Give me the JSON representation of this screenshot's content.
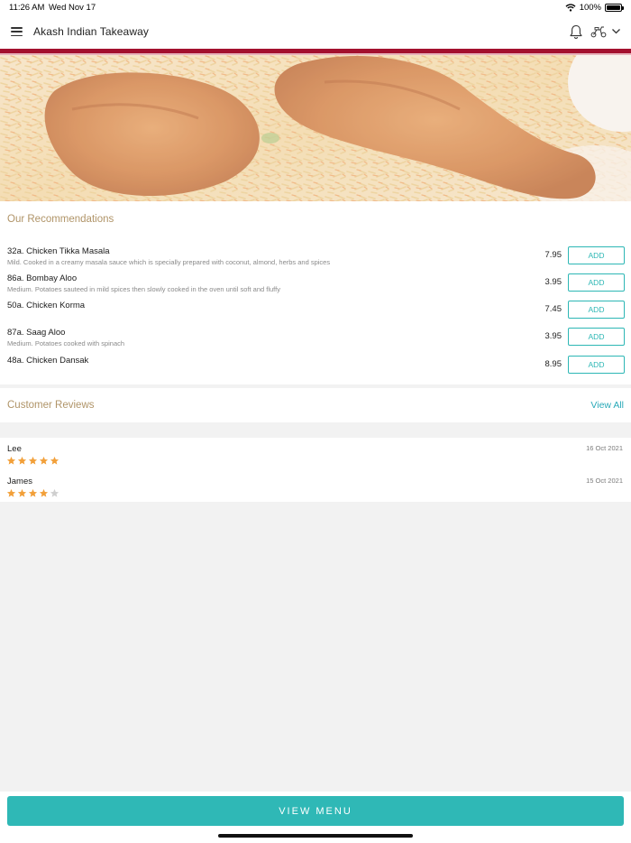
{
  "status_bar": {
    "time": "11:26 AM",
    "date": "Wed Nov 17",
    "battery": "100%"
  },
  "header": {
    "title": "Akash Indian Takeaway",
    "icons": [
      "menu-icon",
      "bell-icon",
      "scooter-icon",
      "chevron-down-icon"
    ],
    "brand_color": "#a3102e"
  },
  "recommendations": {
    "title": "Our Recommendations",
    "add_label": "ADD",
    "items": [
      {
        "name": "32a. Chicken Tikka Masala",
        "description": "Mild. Cooked in a creamy masala sauce which is specially prepared with coconut, almond, herbs and spices",
        "price": "7.95"
      },
      {
        "name": "86a. Bombay Aloo",
        "description": "Medium. Potatoes sauteed in mild spices then slowly cooked in the oven until soft and fluffy",
        "price": "3.95"
      },
      {
        "name": "50a. Chicken Korma",
        "description": "",
        "price": "7.45"
      },
      {
        "name": "87a. Saag Aloo",
        "description": "Medium. Potatoes cooked with spinach",
        "price": "3.95"
      },
      {
        "name": "48a. Chicken Dansak",
        "description": "",
        "price": "8.95"
      }
    ]
  },
  "reviews": {
    "title": "Customer Reviews",
    "view_all": "View All",
    "items": [
      {
        "name": "Lee",
        "date": "16 Oct 2021",
        "rating": 5,
        "max_rating": 5
      },
      {
        "name": "James",
        "date": "15 Oct 2021",
        "rating": 4,
        "max_rating": 5
      }
    ]
  },
  "footer": {
    "view_menu_label": "VIEW MENU",
    "accent_color": "#2fb8b6"
  }
}
